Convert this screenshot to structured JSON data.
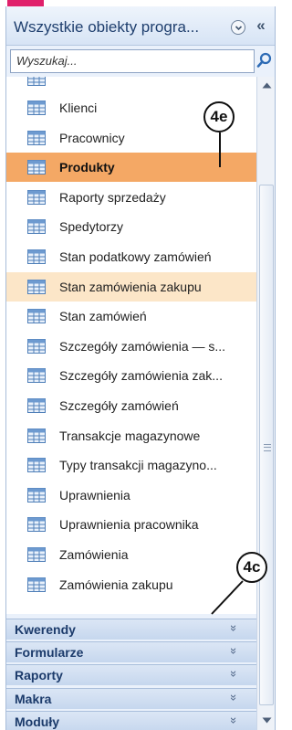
{
  "header": {
    "title": "Wszystkie obiekty progra...",
    "options_icon": "chevron-down-circle-icon",
    "collapse_icon": "double-chevron-left-icon",
    "collapse_glyph": "«"
  },
  "search": {
    "placeholder": "Wyszukaj..."
  },
  "items": [
    {
      "label": "Klienci",
      "state": "normal"
    },
    {
      "label": "Pracownicy",
      "state": "normal"
    },
    {
      "label": "Produkty",
      "state": "selected"
    },
    {
      "label": "Raporty sprzedaży",
      "state": "normal"
    },
    {
      "label": "Spedytorzy",
      "state": "normal"
    },
    {
      "label": "Stan podatkowy zamówień",
      "state": "normal"
    },
    {
      "label": "Stan zamówienia zakupu",
      "state": "hover"
    },
    {
      "label": "Stan zamówień",
      "state": "normal"
    },
    {
      "label": "Szczegóły zamówienia — s...",
      "state": "normal"
    },
    {
      "label": "Szczegóły zamówienia zak...",
      "state": "normal"
    },
    {
      "label": "Szczegóły zamówień",
      "state": "normal"
    },
    {
      "label": "Transakcje magazynowe",
      "state": "normal"
    },
    {
      "label": "Typy transakcji magazyno...",
      "state": "normal"
    },
    {
      "label": "Uprawnienia",
      "state": "normal"
    },
    {
      "label": "Uprawnienia pracownika",
      "state": "normal"
    },
    {
      "label": "Zamówienia",
      "state": "normal"
    },
    {
      "label": "Zamówienia zakupu",
      "state": "normal"
    }
  ],
  "groups": [
    {
      "label": "Kwerendy",
      "chevron": "»"
    },
    {
      "label": "Formularze",
      "chevron": "»"
    },
    {
      "label": "Raporty",
      "chevron": "»"
    },
    {
      "label": "Makra",
      "chevron": "»"
    },
    {
      "label": "Moduły",
      "chevron": "»"
    }
  ],
  "callouts": {
    "top": "4e",
    "bottom": "4c"
  },
  "colors": {
    "accent_bar": "#e0206b",
    "selected": "#f4a865",
    "hover": "#fce6c8",
    "group_text": "#1c3b6b"
  }
}
